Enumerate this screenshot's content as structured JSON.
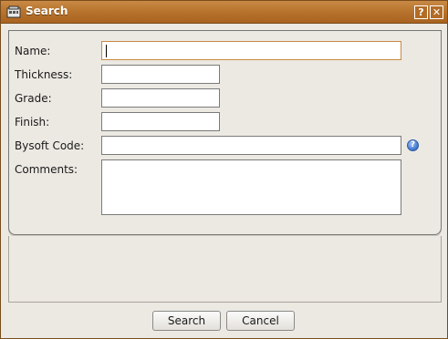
{
  "window": {
    "title": "Search",
    "help_glyph": "?",
    "close_glyph": "✕"
  },
  "form": {
    "name": {
      "label": "Name:",
      "value": ""
    },
    "thickness": {
      "label": "Thickness:",
      "value": ""
    },
    "grade": {
      "label": "Grade:",
      "value": ""
    },
    "finish": {
      "label": "Finish:",
      "value": ""
    },
    "bysoft_code": {
      "label": "Bysoft Code:",
      "value": "",
      "help_icon": "question-icon",
      "help_glyph": "?"
    },
    "comments": {
      "label": "Comments:",
      "value": ""
    }
  },
  "footer": {
    "search_label": "Search",
    "cancel_label": "Cancel"
  },
  "colors": {
    "titlebar": "#b8752e",
    "focus_border": "#c98a45",
    "background": "#ece9e3"
  }
}
